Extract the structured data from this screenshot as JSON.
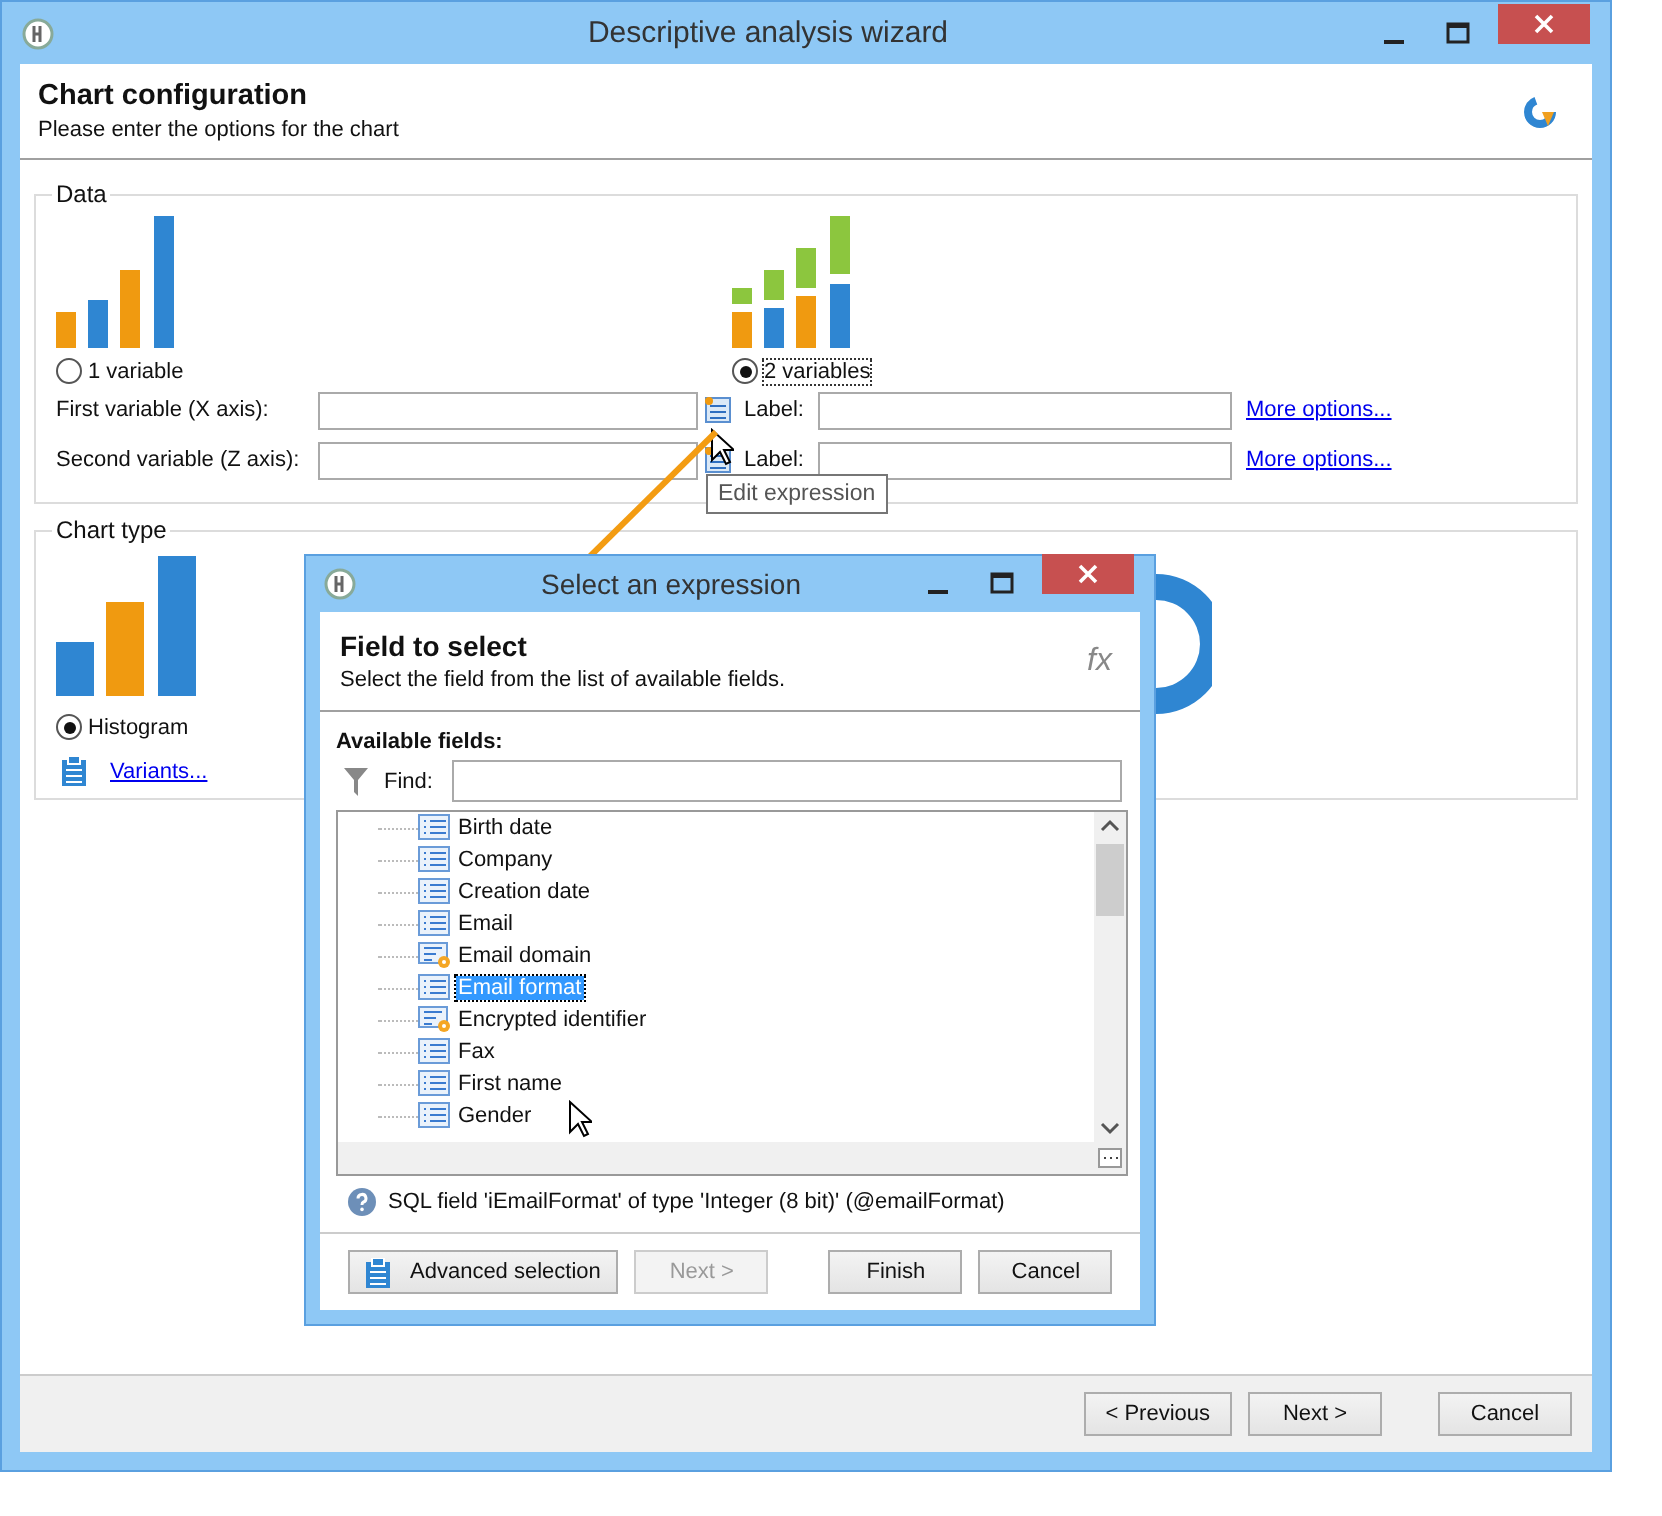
{
  "window": {
    "title": "Descriptive analysis wizard"
  },
  "header": {
    "title": "Chart configuration",
    "subtitle": "Please enter the options for the chart"
  },
  "data_group": {
    "legend": "Data",
    "options": [
      {
        "label": "1 variable",
        "kind": "single",
        "selected": false
      },
      {
        "label": "2 variables",
        "kind": "double",
        "selected": true
      }
    ],
    "fields": [
      {
        "label": "First variable (X axis):",
        "caption": "Label:",
        "link": "More options..."
      },
      {
        "label": "Second variable (Z axis):",
        "caption": "Label:",
        "link": "More options..."
      }
    ]
  },
  "tooltip": "Edit expression",
  "chart_type": {
    "legend": "Chart type",
    "option": {
      "label": "Histogram",
      "selected": true
    },
    "link": "Variants..."
  },
  "buttons": [
    {
      "label": "< Previous",
      "disabled": false
    },
    {
      "label": "Next >",
      "disabled": false
    },
    {
      "label": "Cancel",
      "disabled": false
    }
  ],
  "dialog": {
    "title": "Select an expression",
    "header": {
      "title": "Field to select",
      "subtitle": "Select the field from the list of available fields.",
      "symbol": "fx"
    },
    "list_label": "Available fields:",
    "find_label": "Find:",
    "fields": [
      {
        "label": "Birth date",
        "kind": "plain",
        "selected": false
      },
      {
        "label": "Company",
        "kind": "plain",
        "selected": false
      },
      {
        "label": "Creation date",
        "kind": "plain",
        "selected": false
      },
      {
        "label": "Email",
        "kind": "plain",
        "selected": false
      },
      {
        "label": "Email domain",
        "kind": "computed",
        "selected": false
      },
      {
        "label": "Email format",
        "kind": "plain",
        "selected": true
      },
      {
        "label": "Encrypted identifier",
        "kind": "computed",
        "selected": false
      },
      {
        "label": "Fax",
        "kind": "plain",
        "selected": false
      },
      {
        "label": "First name",
        "kind": "plain",
        "selected": false
      },
      {
        "label": "Gender",
        "kind": "plain",
        "selected": false
      }
    ],
    "info": "SQL field 'iEmailFormat' of type 'Integer (8 bit)' (@emailFormat)",
    "buttons": [
      {
        "label": "Advanced selection",
        "kind": "icon",
        "disabled": false
      },
      {
        "label": "Next >",
        "kind": "plain",
        "disabled": true
      },
      {
        "label": "Finish",
        "kind": "plain",
        "disabled": false
      },
      {
        "label": "Cancel",
        "kind": "plain",
        "disabled": false
      }
    ]
  }
}
